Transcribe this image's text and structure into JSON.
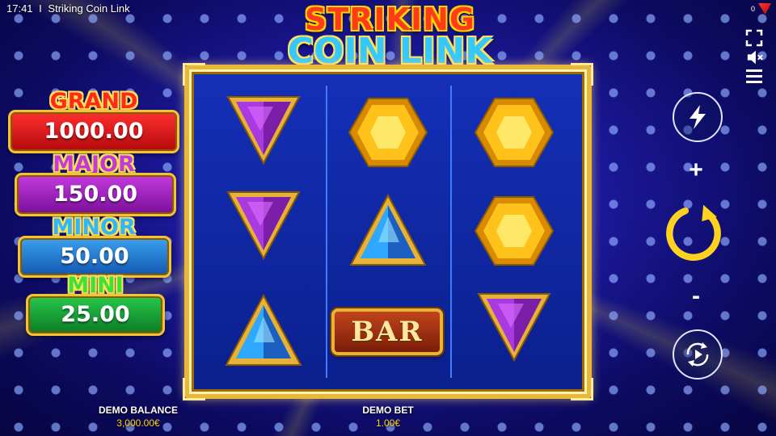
{
  "status_bar": {
    "time": "17:41",
    "separator": "I",
    "game_title": "Striking Coin Link"
  },
  "brand_badge": {
    "count": "0"
  },
  "logo": {
    "line1": "STRIKING",
    "line2": "COIN LINK"
  },
  "jackpots": [
    {
      "name": "GRAND",
      "value": "1000.00",
      "color": "#e0141a",
      "title_color": "#ff2a1a"
    },
    {
      "name": "MAJOR",
      "value": "150.00",
      "color": "#a51fc4",
      "title_color": "#c23ad8"
    },
    {
      "name": "MINOR",
      "value": "50.00",
      "color": "#1f7ed8",
      "title_color": "#2fb6ff"
    },
    {
      "name": "MINI",
      "value": "25.00",
      "color": "#17a33a",
      "title_color": "#3fe03a"
    }
  ],
  "reels": [
    [
      "purple-triangle",
      "purple-triangle",
      "blue-triangle"
    ],
    [
      "yellow-hexagon",
      "blue-triangle",
      "bar"
    ],
    [
      "yellow-hexagon",
      "yellow-hexagon",
      "purple-triangle"
    ]
  ],
  "symbols": {
    "bar_label": "BAR"
  },
  "controls": {
    "plus_label": "+",
    "minus_label": "-",
    "icons": [
      "fullscreen-icon",
      "sound-muted-icon",
      "menu-icon",
      "lightning-icon",
      "spin-icon",
      "autoplay-icon"
    ]
  },
  "footer": {
    "balance_label": "DEMO BALANCE",
    "balance_value": "3,000.00€",
    "bet_label": "DEMO BET",
    "bet_value": "1.00€"
  },
  "colors": {
    "frame_gold": "#e8b83a",
    "spin_yellow": "#ffd21f",
    "accent_blue": "#2fb6ff"
  }
}
